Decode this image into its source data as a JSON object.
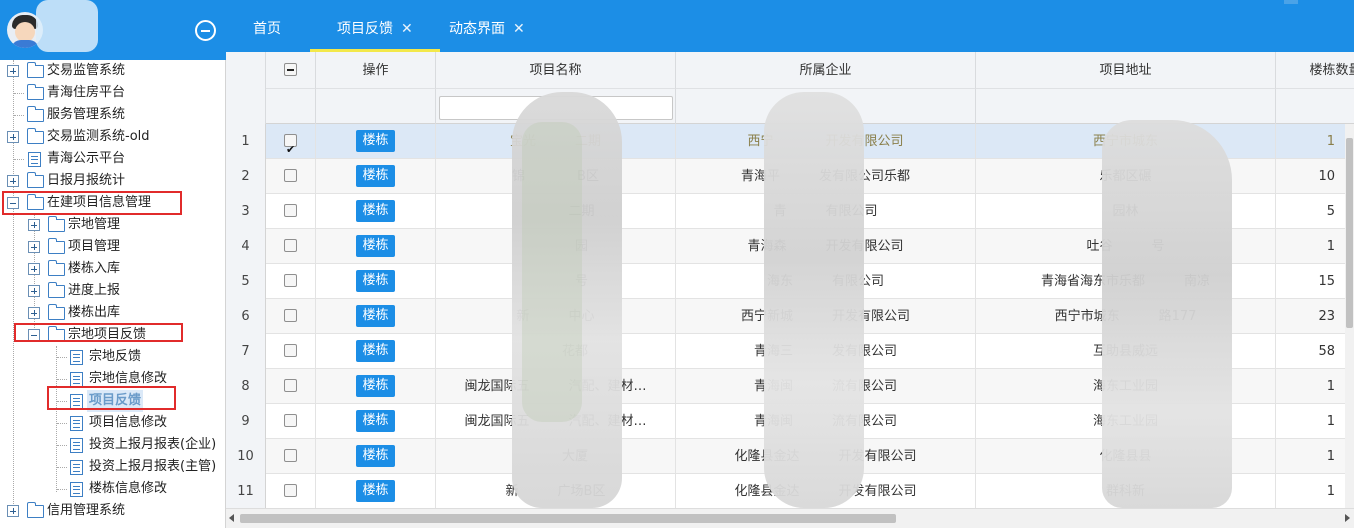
{
  "sidebar": {
    "tree": [
      {
        "label": "交易监管系统",
        "icon": "folder-icon"
      },
      {
        "label": "青海住房平台",
        "icon": "folder-icon"
      },
      {
        "label": "服务管理系统",
        "icon": "folder-icon"
      },
      {
        "label": "交易监测系统-old",
        "icon": "folder-icon"
      },
      {
        "label": "青海公示平台",
        "icon": "document-icon"
      },
      {
        "label": "日报月报统计",
        "icon": "folder-icon"
      },
      {
        "label": "在建项目信息管理",
        "icon": "folder-icon"
      },
      {
        "label": "宗地管理",
        "icon": "folder-icon"
      },
      {
        "label": "项目管理",
        "icon": "folder-icon"
      },
      {
        "label": "楼栋入库",
        "icon": "folder-icon"
      },
      {
        "label": "进度上报",
        "icon": "folder-icon"
      },
      {
        "label": "楼栋出库",
        "icon": "folder-icon"
      },
      {
        "label": "宗地项目反馈",
        "icon": "folder-icon"
      },
      {
        "label": "宗地反馈",
        "icon": "document-icon"
      },
      {
        "label": "宗地信息修改",
        "icon": "document-icon"
      },
      {
        "label": "项目反馈",
        "icon": "document-icon"
      },
      {
        "label": "项目信息修改",
        "icon": "document-icon"
      },
      {
        "label": "投资上报月报表(企业)",
        "icon": "document-icon"
      },
      {
        "label": "投资上报月报表(主管)",
        "icon": "document-icon"
      },
      {
        "label": "楼栋信息修改",
        "icon": "document-icon"
      },
      {
        "label": "信用管理系统",
        "icon": "folder-icon"
      }
    ]
  },
  "tabs": [
    {
      "label": "首页",
      "closable": false,
      "active": false
    },
    {
      "label": "项目反馈",
      "closable": true,
      "active": true
    },
    {
      "label": "动态界面",
      "closable": true,
      "active": false
    }
  ],
  "tab_close_glyph": "✕",
  "grid": {
    "columns": [
      "操作",
      "项目名称",
      "所属企业",
      "项目地址",
      "楼栋数量"
    ],
    "action_label": "楼栋",
    "rows": [
      {
        "num": "1",
        "checked": true,
        "name": "宝光　　　二期",
        "company": "西宁　　　　开发有限公司",
        "address": "西宁市城东",
        "count": "1"
      },
      {
        "num": "2",
        "checked": false,
        "name": "锦　　　　B区",
        "company": "青海平　　　发有限公司乐都",
        "address": "乐都区碾",
        "count": "10"
      },
      {
        "num": "3",
        "checked": false,
        "name": "　　　　二期",
        "company": "青　　　有限公司",
        "address": "园林",
        "count": "5"
      },
      {
        "num": "4",
        "checked": false,
        "name": "　　　　园",
        "company": "青海森　　　开发有限公司",
        "address": "吐谷　　　号",
        "count": "1"
      },
      {
        "num": "5",
        "checked": false,
        "name": "　　　　号",
        "company": "海东　　　有限公司",
        "address": "青海省海东市乐都　　　南凉",
        "count": "15"
      },
      {
        "num": "6",
        "checked": false,
        "name": "新　　　中心",
        "company": "西宁新城　　　开发有限公司",
        "address": "西宁市城东　　　路177",
        "count": "23"
      },
      {
        "num": "7",
        "checked": false,
        "name": "　　　花都",
        "company": "青海三　　　发有限公司",
        "address": "互助县威远",
        "count": "58"
      },
      {
        "num": "8",
        "checked": false,
        "name": "闽龙国际五　　　汽配、建材…",
        "company": "青海闽　　　流有限公司",
        "address": "海东工业园",
        "count": "1"
      },
      {
        "num": "9",
        "checked": false,
        "name": "闽龙国际五　　　汽配、建材…",
        "company": "青海闽　　　流有限公司",
        "address": "海东工业园",
        "count": "1"
      },
      {
        "num": "10",
        "checked": false,
        "name": "　　　大厦",
        "company": "化隆县金达　　　开发有限公司",
        "address": "化隆县县",
        "count": "1"
      },
      {
        "num": "11",
        "checked": false,
        "name": "新　　　广场B区",
        "company": "化隆县金达　　　开发有限公司",
        "address": "群科新",
        "count": "1"
      }
    ]
  },
  "colors": {
    "header_blue": "#1c8ee6",
    "tab_underline": "#f3e84a",
    "highlight_red": "#e12b2b",
    "selected_row": "#dce8f6"
  }
}
